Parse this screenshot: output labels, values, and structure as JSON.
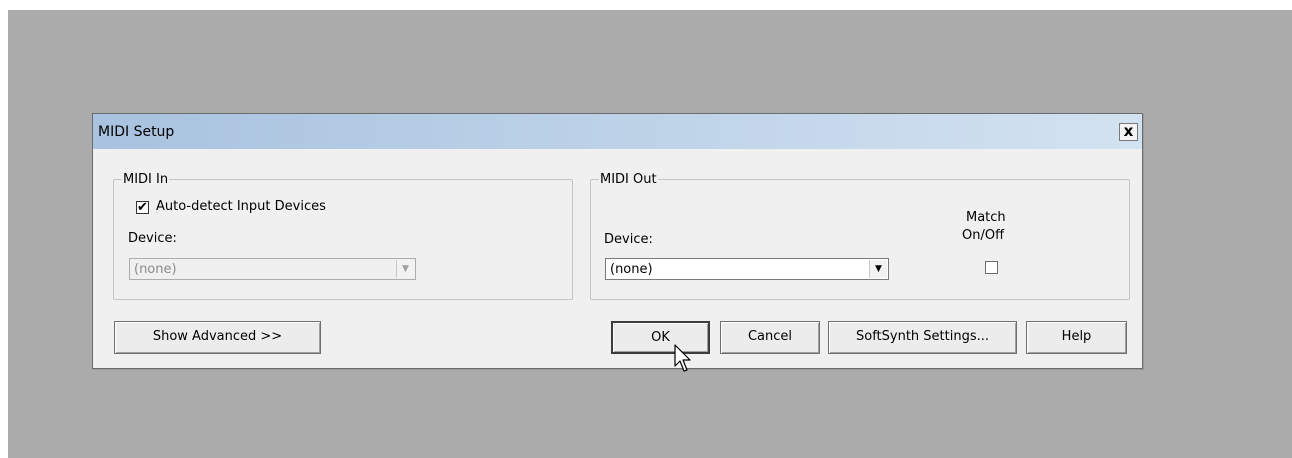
{
  "dialog": {
    "title": "MIDI Setup",
    "close_label": "x"
  },
  "midi_in": {
    "legend": "MIDI In",
    "auto_detect_checked": true,
    "auto_detect_label": "Auto-detect Input Devices",
    "device_label": "Device:",
    "device_value": "(none)"
  },
  "midi_out": {
    "legend": "MIDI Out",
    "device_label": "Device:",
    "device_value": "(none)",
    "match_label_line1": "Match",
    "match_label_line2": "On/Off",
    "match_checked": false
  },
  "buttons": {
    "show_advanced": "Show Advanced  >>",
    "ok": "OK",
    "cancel": "Cancel",
    "softsynth": "SoftSynth Settings...",
    "help": "Help"
  },
  "icons": {
    "close": "close-icon",
    "dropdown": "chevron-down-icon",
    "cursor": "mouse-pointer-icon"
  }
}
